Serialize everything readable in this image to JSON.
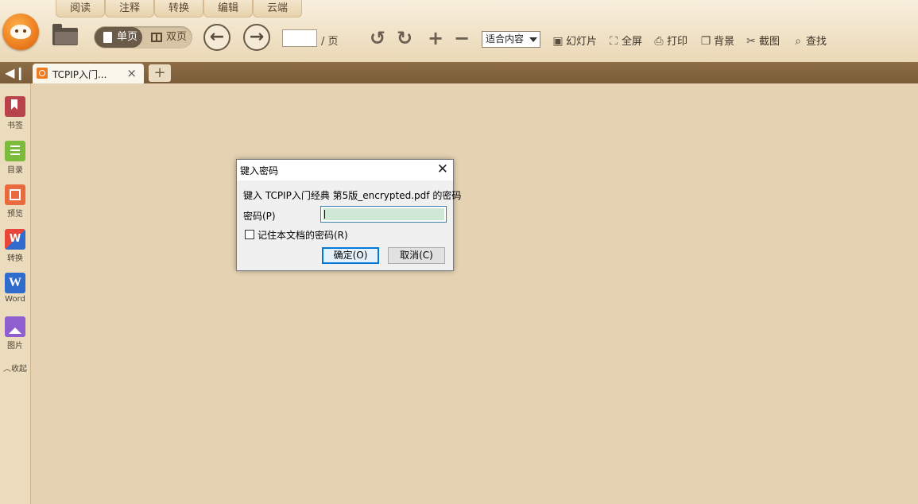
{
  "menu_tabs": [
    "阅读",
    "注释",
    "转换",
    "编辑",
    "云端"
  ],
  "toolbar": {
    "single_page": "单页",
    "dual_page": "双页",
    "page_input_value": "",
    "page_suffix": "/ 页",
    "zoom_selected": "适合内容",
    "slideshow": "幻灯片",
    "fullscreen": "全屏",
    "print": "打印",
    "background": "背景",
    "screenshot": "截图",
    "search": "查找"
  },
  "tab": {
    "label": "TCPIP入门...",
    "close": "×",
    "new": "+"
  },
  "sidebar": {
    "items": [
      "书签",
      "目录",
      "预览",
      "转换",
      "Word",
      "图片"
    ],
    "collapse": "收起",
    "word_glyph": "W",
    "convert_glyph": "W"
  },
  "dialog": {
    "title": "键入密码",
    "message": "键入 TCPIP入门经典 第5版_encrypted.pdf 的密码",
    "password_label": "密码(P)",
    "password_value": "",
    "remember_label": "记住本文档的密码(R)",
    "ok": "确定(O)",
    "cancel": "取消(C)"
  },
  "colors": {
    "accent_orange": "#e8761a",
    "tabbar_brown": "#7a5c38",
    "content_bg": "#e4d2b2"
  }
}
